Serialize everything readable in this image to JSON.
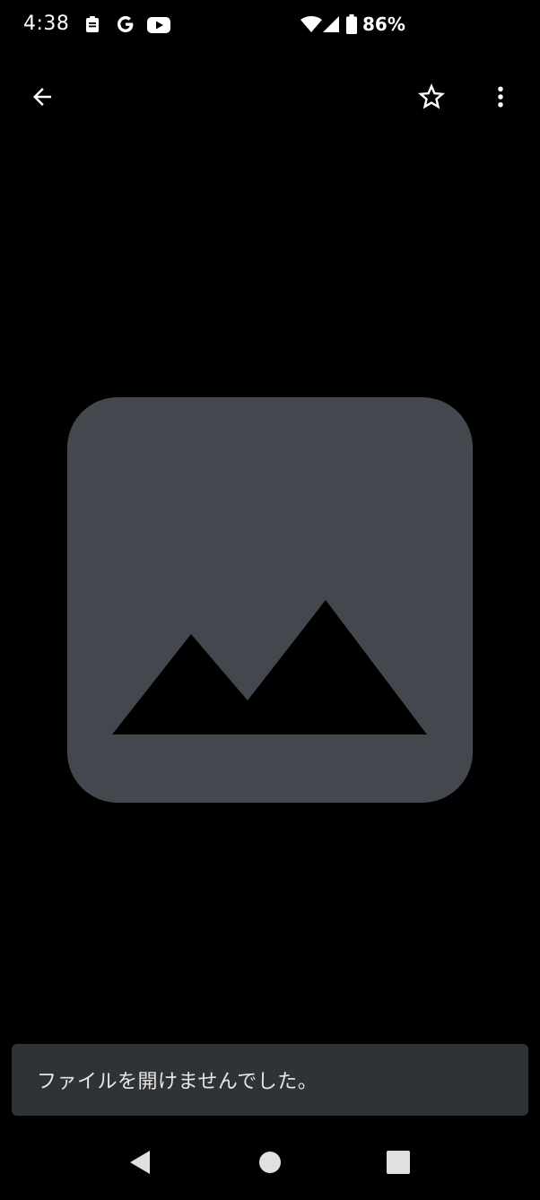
{
  "status_bar": {
    "time": "4:38",
    "battery_percent": "86%",
    "notification_icons": [
      "clipboard-icon",
      "google-icon",
      "youtube-icon"
    ],
    "system_icons": [
      "wifi-icon",
      "cellular-signal-icon",
      "battery-icon"
    ]
  },
  "app_bar": {
    "back_icon": "arrow-back-icon",
    "star_icon": "star-outline-icon",
    "menu_icon": "more-vertical-icon"
  },
  "content": {
    "placeholder_icon": "image-placeholder-icon",
    "colors": {
      "placeholder_bg": "#42484e",
      "background": "#000000"
    }
  },
  "snackbar": {
    "message": "ファイルを開けませんでした。",
    "bg_color": "#2f3336"
  },
  "nav_bar": {
    "back": "nav-back-icon",
    "home": "nav-home-icon",
    "recents": "nav-recents-icon"
  }
}
